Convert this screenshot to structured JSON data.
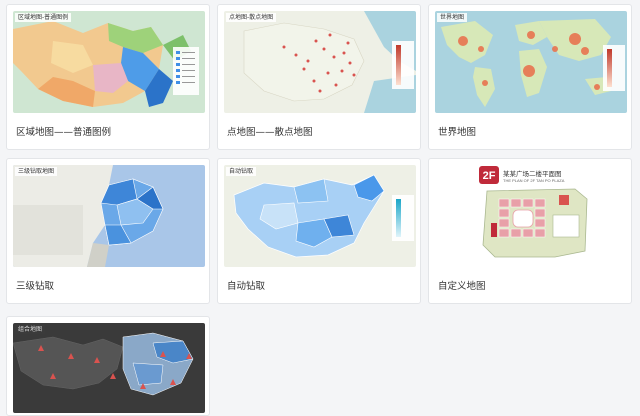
{
  "cards": [
    {
      "tag": "区域地图-普通图例",
      "label": "区域地图——普通图例"
    },
    {
      "tag": "点地图-散点地图",
      "label": "点地图——散点地图"
    },
    {
      "tag": "世界地图",
      "label": "世界地图"
    },
    {
      "tag": "三级钻取地图",
      "label": "三级钻取"
    },
    {
      "tag": "自动钻取",
      "label": "自动钻取"
    },
    {
      "tag": "",
      "label": "自定义地图",
      "floor": "2F",
      "floor_title": "某某广场二楼平面图",
      "floor_subtitle": "THE PLAN OF 2F TAN PO PLAZA"
    },
    {
      "tag": "组合地图",
      "label": ""
    }
  ],
  "colors": {
    "card_border": "#e3e5e8",
    "page_bg": "#f4f5f7",
    "map_blue": "#3f8fe6",
    "water": "#aad3df",
    "land": "#eef0e6",
    "floor_red": "#c02a3a"
  }
}
